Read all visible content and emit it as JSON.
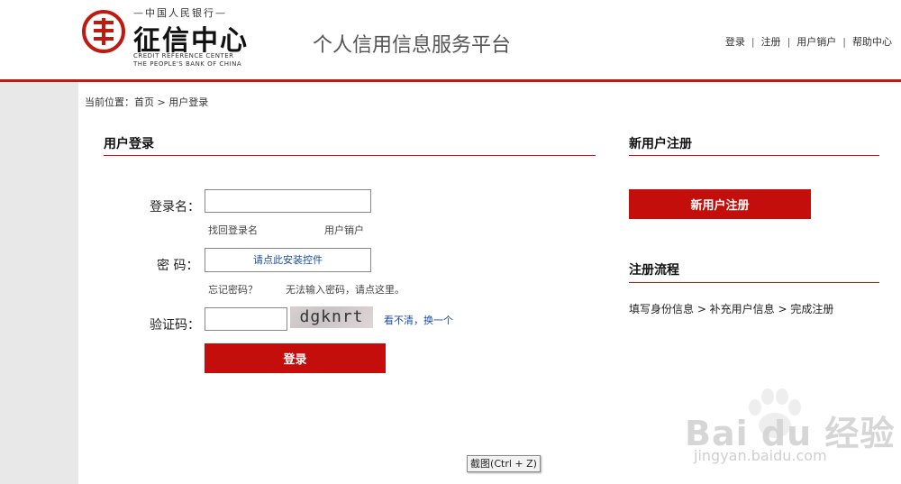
{
  "header": {
    "logo_top": "—中国人民银行—",
    "logo_main": "征信中心",
    "logo_en_line1": "CREDIT REFERENCE CENTER",
    "logo_en_line2": "THE PEOPLE'S BANK OF CHINA",
    "platform_title": "个人信用信息服务平台",
    "nav": [
      "登录",
      "注册",
      "用户销户",
      "帮助中心"
    ],
    "nav_separator": "|"
  },
  "breadcrumb": "当前位置：首页 > 用户登录",
  "login": {
    "section_title": "用户登录",
    "username_label": "登录名：",
    "username_value": "",
    "find_username_link": "找回登录名",
    "cancel_account_link": "用户销户",
    "password_label": "密  码：",
    "password_install_prompt": "请点此安装控件",
    "forgot_password_link": "忘记密码？",
    "cannot_input_link": "无法输入密码，请点这里。",
    "captcha_label": "验证码：",
    "captcha_value": "",
    "captcha_text": "dgknrt",
    "refresh_captcha_link": "看不清，换一个",
    "submit_label": "登录"
  },
  "register": {
    "section_title": "新用户注册",
    "button_label": "新用户注册",
    "flow_title": "注册流程",
    "flow_steps": "填写身份信息 > 补充用户信息 > 完成注册"
  },
  "tooltip": "截图(Ctrl + Z)",
  "watermark": {
    "text": "Bai du 经验",
    "url": "jingyan.baidu.com"
  },
  "colors": {
    "accent_red": "#c30e0b",
    "link_blue": "#1a4fa3"
  }
}
